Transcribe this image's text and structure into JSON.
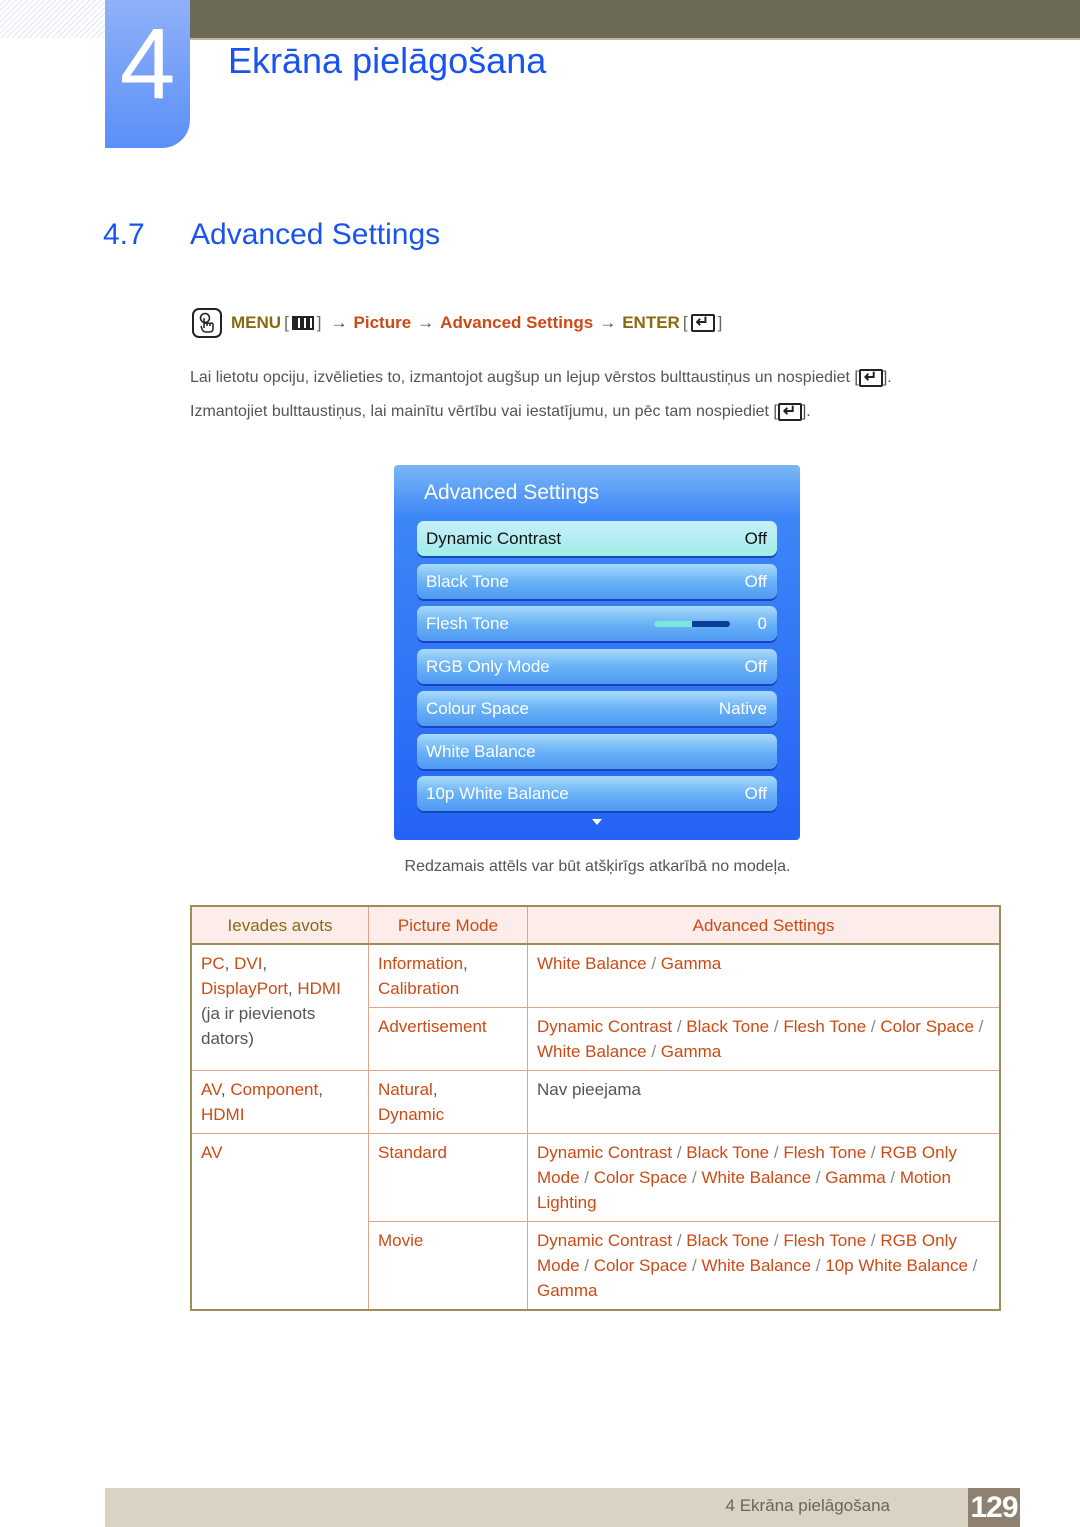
{
  "header": {
    "chapter_number": "4",
    "chapter_title": "Ekrāna pielāgošana"
  },
  "section": {
    "number": "4.7",
    "title": "Advanced Settings"
  },
  "nav_path": {
    "icon": "hand-remote-icon",
    "menu_label": "MENU",
    "menu_icon": "menu-grid-icon",
    "step1": "Picture",
    "step2": "Advanced Settings",
    "enter_label": "ENTER",
    "enter_icon": "enter-key-icon",
    "arrow": "→",
    "bracket_open": "[",
    "bracket_close": "]"
  },
  "instructions": {
    "line1": "Lai lietotu opciju, izvēlieties to, izmantojot augšup un lejup vērstos bulttaustiņus un nospiediet [",
    "line1_end": "].",
    "line2": "Izmantojiet bulttaustiņus, lai mainītu vērtību vai iestatījumu, un pēc tam nospiediet [",
    "line2_end": "]."
  },
  "osd": {
    "title": "Advanced Settings",
    "items": [
      {
        "label": "Dynamic Contrast",
        "value": "Off",
        "selected": true
      },
      {
        "label": "Black Tone",
        "value": "Off"
      },
      {
        "label": "Flesh Tone",
        "value": "0",
        "slider_fraction": 0.5
      },
      {
        "label": "RGB Only Mode",
        "value": "Off"
      },
      {
        "label": "Colour Space",
        "value": "Native"
      },
      {
        "label": "White Balance",
        "value": ""
      },
      {
        "label": "10p White Balance",
        "value": "Off"
      }
    ],
    "scroll_indicator": "down-arrow-icon"
  },
  "caption": "Redzamais attēls var būt atšķirīgs atkarībā no modeļa.",
  "table": {
    "headers": [
      "Ievades avots",
      "Picture Mode",
      "Advanced Settings"
    ],
    "rows": [
      {
        "source_parts": [
          "PC",
          ", ",
          "DVI",
          ",",
          "DisplayPort",
          ", ",
          "HDMI"
        ],
        "source_note": "(ja ir pievienots dators)",
        "mode": "Information, Calibration",
        "mode_parts": [
          "Information",
          ",",
          "Calibration"
        ],
        "settings": [
          "White Balance",
          "Gamma"
        ]
      },
      {
        "mode_parts": [
          "Advertisement"
        ],
        "settings": [
          "Dynamic Contrast",
          "Black Tone",
          "Flesh Tone",
          "Color Space",
          "White Balance",
          "Gamma"
        ]
      },
      {
        "source_parts": [
          "AV",
          ", ",
          "Component",
          ",",
          "HDMI"
        ],
        "mode_parts": [
          "Natural",
          ",",
          "Dynamic"
        ],
        "settings_text": "Nav pieejama"
      },
      {
        "source_parts": [
          "AV"
        ],
        "mode_parts": [
          "Standard"
        ],
        "settings": [
          "Dynamic Contrast",
          "Black Tone",
          "Flesh Tone",
          "RGB Only Mode",
          "Color Space",
          "White Balance",
          "Gamma",
          "Motion Lighting"
        ]
      },
      {
        "mode_parts": [
          "Movie"
        ],
        "settings": [
          "Dynamic Contrast",
          "Black Tone",
          "Flesh Tone",
          "RGB Only Mode",
          "Color Space",
          "White Balance",
          "10p White Balance",
          "Gamma"
        ]
      }
    ],
    "separator": " / "
  },
  "footer": {
    "chapter_label": "4 Ekrāna pielāgošana",
    "page_number": "129"
  },
  "colors": {
    "heading_blue": "#1a54f0",
    "keyword_red": "#cc4a14",
    "keyword_gold": "#8a6a10",
    "osd_blue": "#2463f5",
    "topbar": "#6d6b56",
    "footer_bar": "#d8d3c2",
    "page_badge": "#8f8170"
  }
}
